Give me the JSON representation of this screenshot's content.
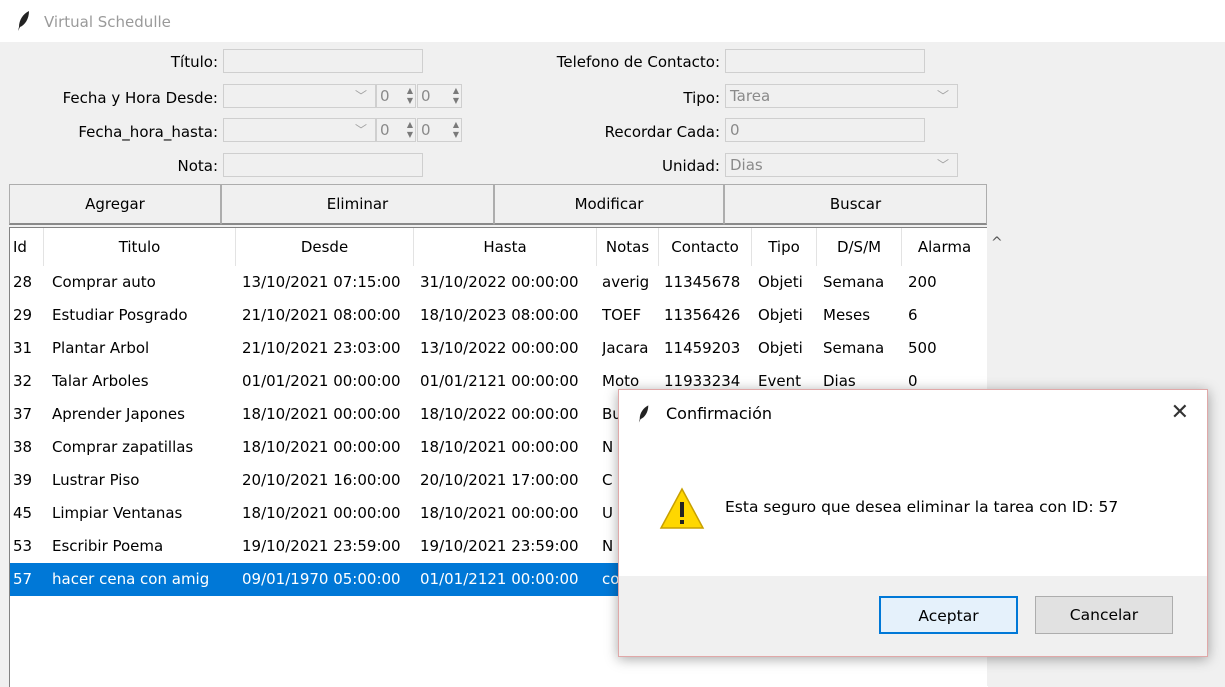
{
  "window": {
    "title": "Virtual Schedulle"
  },
  "form": {
    "titulo_label": "Título:",
    "fecha_desde_label": "Fecha y Hora Desde:",
    "fecha_hasta_label": "Fecha_hora_hasta:",
    "nota_label": "Nota:",
    "telefono_label": "Telefono de Contacto:",
    "tipo_label": "Tipo:",
    "recordar_label": "Recordar Cada:",
    "unidad_label": "Unidad:",
    "tipo_value": "Tarea",
    "recordar_value": "0",
    "unidad_value": "Dias",
    "desde_hour": "0",
    "desde_min": "0",
    "hasta_hour": "0",
    "hasta_min": "0"
  },
  "buttons": {
    "agregar": "Agregar",
    "eliminar": "Eliminar",
    "modificar": "Modificar",
    "buscar": "Buscar"
  },
  "table": {
    "headers": [
      "Id",
      "Titulo",
      "Desde",
      "Hasta",
      "Notas",
      "Contacto",
      "Tipo",
      "D/S/M",
      "Alarma"
    ],
    "rows": [
      [
        "28",
        "Comprar auto",
        "13/10/2021 07:15:00",
        "31/10/2022 00:00:00",
        "averig",
        "11345678",
        "Objeti",
        "Semana",
        "200"
      ],
      [
        "29",
        "Estudiar Posgrado",
        "21/10/2021 08:00:00",
        "18/10/2023 08:00:00",
        "TOEF",
        "11356426",
        "Objeti",
        "Meses",
        "6"
      ],
      [
        "31",
        "Plantar Arbol",
        "21/10/2021 23:03:00",
        "13/10/2022 00:00:00",
        "Jacara",
        "11459203",
        "Objeti",
        "Semana",
        "500"
      ],
      [
        "32",
        "Talar Arboles",
        "01/01/2021 00:00:00",
        "01/01/2121 00:00:00",
        "Moto",
        "11933234",
        "Event",
        "Dias",
        "0"
      ],
      [
        "37",
        "Aprender Japones",
        "18/10/2021 00:00:00",
        "18/10/2022 00:00:00",
        "Bu",
        "",
        "",
        "",
        ""
      ],
      [
        "38",
        "Comprar zapatillas",
        "18/10/2021 00:00:00",
        "18/10/2021 00:00:00",
        "N",
        "",
        "",
        "",
        ""
      ],
      [
        "39",
        "Lustrar Piso",
        "20/10/2021 16:00:00",
        "20/10/2021 17:00:00",
        "C",
        "",
        "",
        "",
        ""
      ],
      [
        "45",
        "Limpiar Ventanas",
        "18/10/2021 00:00:00",
        "18/10/2021 00:00:00",
        "U",
        "",
        "",
        "",
        ""
      ],
      [
        "53",
        "Escribir Poema",
        "19/10/2021 23:59:00",
        "19/10/2021 23:59:00",
        "N",
        "",
        "",
        "",
        ""
      ],
      [
        "57",
        "hacer cena con amig",
        "09/01/1970 05:00:00",
        "01/01/2121 00:00:00",
        "co",
        "",
        "",
        "",
        ""
      ]
    ],
    "selected_index": 9
  },
  "dialog": {
    "title": "Confirmación",
    "message": "Esta seguro que desea eliminar la tarea con ID: 57",
    "accept": "Aceptar",
    "cancel": "Cancelar",
    "close_glyph": "✕"
  },
  "colors": {
    "selection": "#0078d7",
    "warning": "#ffd700"
  }
}
